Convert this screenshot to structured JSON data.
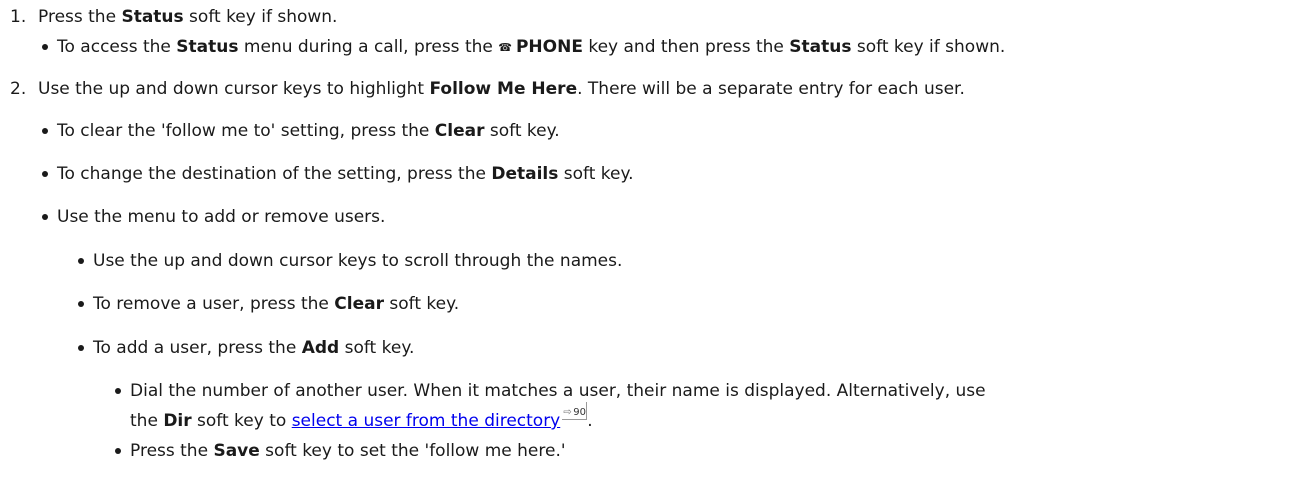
{
  "steps": [
    {
      "number": "1.",
      "parts": [
        "Press the ",
        "Status",
        " soft key if shown."
      ]
    },
    {
      "number": "2.",
      "parts": [
        "Use the up and down cursor keys to highlight ",
        "Follow Me Here",
        ". There will be a separate entry for each user."
      ]
    }
  ],
  "sub1": {
    "parts": [
      "To access the ",
      "Status",
      " menu during a call, press the ",
      "PHONE",
      " key and then press the ",
      "Status",
      " soft key if shown."
    ],
    "icon": "phone-icon"
  },
  "sub2": [
    {
      "parts": [
        "To clear the 'follow me to' setting, press the ",
        "Clear",
        " soft key."
      ]
    },
    {
      "parts": [
        "To change the destination of the setting, press the ",
        "Details",
        " soft key."
      ]
    },
    {
      "parts": [
        "Use the menu to add or remove users."
      ]
    }
  ],
  "sub3": [
    {
      "parts": [
        "Use the up and down cursor keys to scroll through the names."
      ]
    },
    {
      "parts": [
        "To remove a user, press the ",
        "Clear",
        " soft key."
      ]
    },
    {
      "parts": [
        "To add a user, press the ",
        "Add",
        " soft key."
      ]
    }
  ],
  "sub4": {
    "dial": {
      "line1": "Dial the number of another user. When it matches a user, their name is displayed.  Alternatively, use",
      "line2_parts": [
        "the ",
        "Dir",
        " soft key to "
      ],
      "link_text": "select a user from the directory",
      "page_ref": "90",
      "end": "."
    },
    "save": {
      "parts": [
        "Press the ",
        "Save",
        " soft key to set the 'follow me here.'"
      ]
    }
  }
}
